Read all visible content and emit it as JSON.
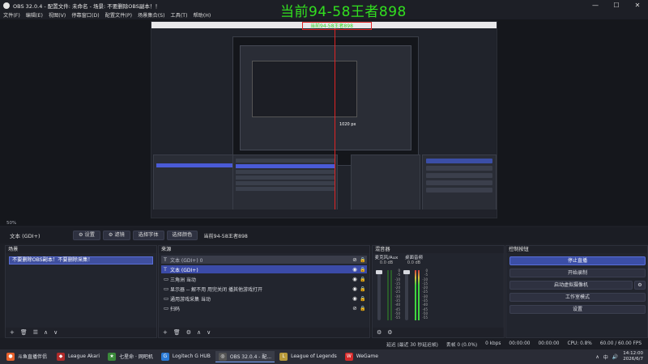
{
  "window": {
    "title": "OBS 32.0.4 - 配置文件: 未命名 - 场景: 不要删除OBS副本！！",
    "controls": [
      "—",
      "☐",
      "✕"
    ]
  },
  "menu": [
    "文件(F)",
    "编辑(E)",
    "视图(V)",
    "停靠窗口(D)",
    "配置文件(P)",
    "场景集合(S)",
    "工具(T)",
    "帮助(H)"
  ],
  "overlay_text": "当前94-58王者898",
  "preview": {
    "nested_overlay": "当前94-58王者898",
    "px_label": "1020 px",
    "zoom": "50%"
  },
  "source_bar": {
    "source_name": "文本 (GDI+)",
    "settings_label": "设置",
    "filters_label": "滤镜",
    "select_font_label": "选择字体",
    "select_color_label": "选择颜色",
    "current_text": "当前94-58王者898"
  },
  "scenes": {
    "header": "场景",
    "items": [
      "不要删除OBS副本！不要删除采集！"
    ],
    "tools": [
      "+",
      "🗑",
      "☰",
      "∧",
      "∨"
    ]
  },
  "sources": {
    "header": "来源",
    "items": [
      {
        "icon": "T",
        "name": "文本 (GDI+) 0",
        "visible": false,
        "locked": true
      },
      {
        "icon": "T",
        "name": "文本 (GDI+)",
        "visible": true,
        "locked": true,
        "selected": true
      },
      {
        "icon": "▭",
        "name": "三角洲 当动",
        "visible": true,
        "locked": true
      },
      {
        "icon": "▭",
        "name": "显示器 -- 解不用 用完关闭 播其他游戏打开",
        "visible": true,
        "locked": true
      },
      {
        "icon": "▭",
        "name": "通用游戏采集 当动",
        "visible": true,
        "locked": true
      },
      {
        "icon": "▭",
        "name": "扫码",
        "visible": false,
        "locked": true
      }
    ],
    "tools": [
      "+",
      "🗑",
      "⚙",
      "∧",
      "∨"
    ]
  },
  "mixer": {
    "header": "混音器",
    "channels": [
      {
        "name": "麦克风/Aux",
        "db": "0.0 dB"
      },
      {
        "name": "桌面音频",
        "db": "0.0 dB"
      }
    ],
    "scale": [
      "0",
      "-5",
      "-10",
      "-15",
      "-20",
      "-25",
      "-30",
      "-35",
      "-40",
      "-45",
      "-50",
      "-55",
      "-60"
    ]
  },
  "controls": {
    "header": "控制按钮",
    "stop_stream": "停止直播",
    "start_recording": "开始录制",
    "start_virtual_cam": "启动虚拟摄像机",
    "studio_mode": "工作室模式",
    "settings": "设置"
  },
  "status": {
    "stream_info": "延迟 (最近 30 秒延迟帧)",
    "dropped": "丢帧 0 (0.0%)",
    "kbps": "0 kbps",
    "rec_time": "00:00:00",
    "stream_time": "00:00:00",
    "cpu": "CPU: 0.8%",
    "fps": "60.00 / 60.00 FPS"
  },
  "taskbar": {
    "items": [
      {
        "label": "斗鱼直播伴侣",
        "color": "#e8612c"
      },
      {
        "label": "League Akari",
        "color": "#b02a2a"
      },
      {
        "label": "七星命 · 网吧机",
        "color": "#3a8a3a"
      },
      {
        "label": "Logitech G HUB",
        "color": "#2a7ad6"
      },
      {
        "label": "OBS 32.0.4 - 配...",
        "color": "#3a3d48",
        "active": true
      },
      {
        "label": "League of Legends",
        "color": "#b89a3a"
      },
      {
        "label": "WeGame",
        "color": "#d62a2a"
      }
    ],
    "tray": [
      "∧",
      "中",
      "🔊"
    ],
    "time": "14:12:00",
    "date": "2026/6/7"
  }
}
